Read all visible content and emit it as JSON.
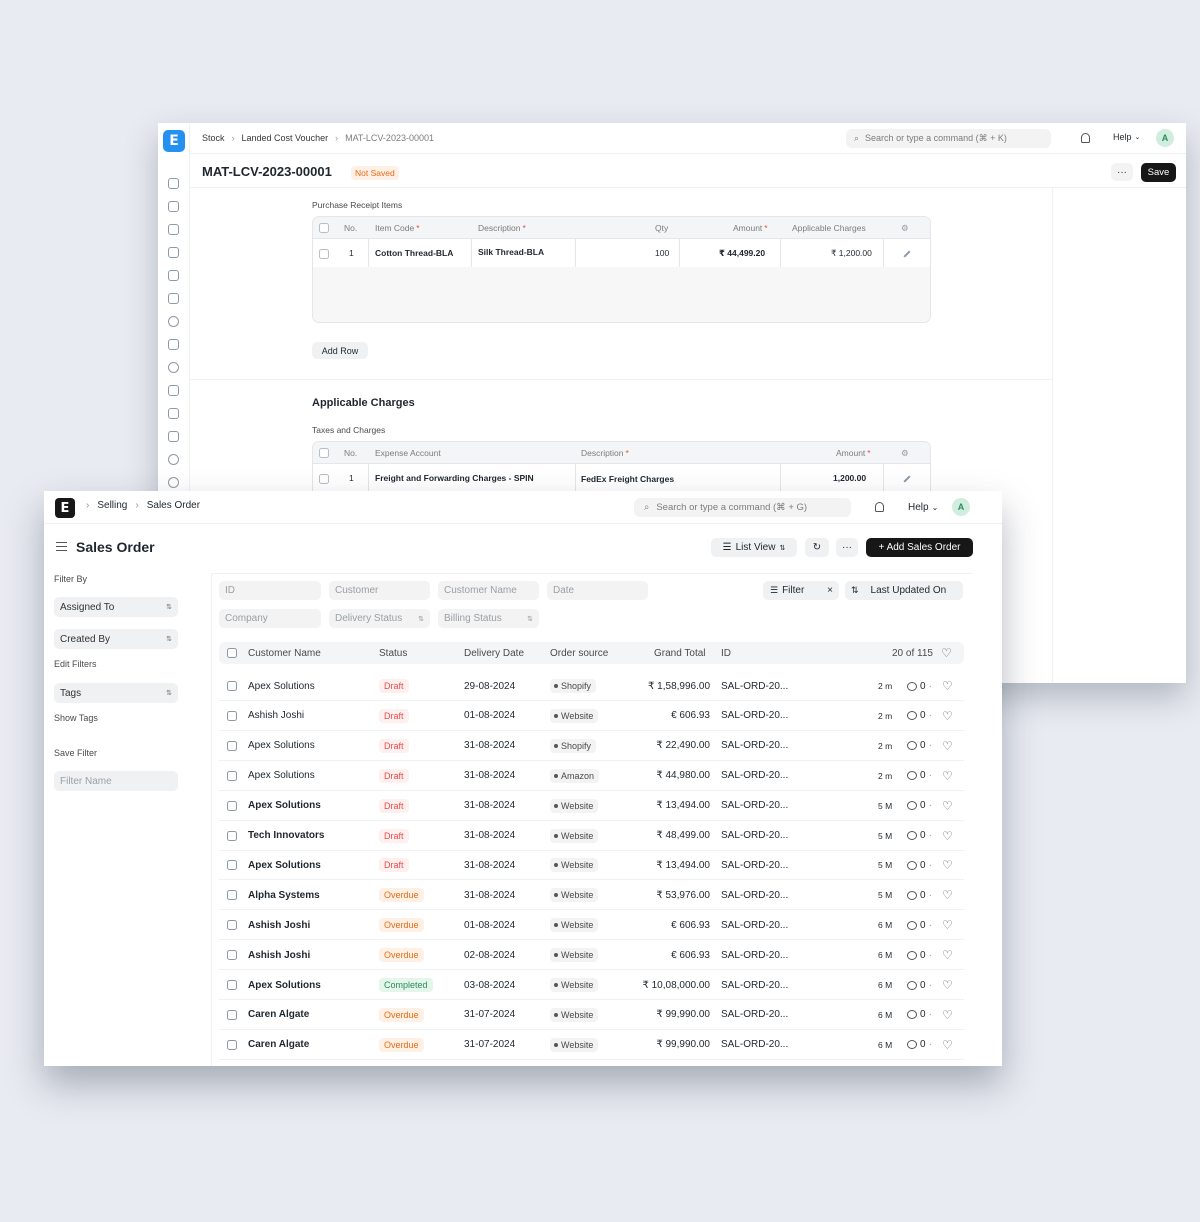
{
  "back": {
    "breadcrumb": [
      "Stock",
      "Landed Cost Voucher",
      "MAT-LCV-2023-00001"
    ],
    "search_placeholder": "Search or type a command (⌘ + K)",
    "help": "Help",
    "avatar": "A",
    "title": "MAT-LCV-2023-00001",
    "status": "Not Saved",
    "save": "Save",
    "more": "···",
    "receipts": {
      "section_label": "Purchase Receipt Items",
      "columns": [
        "No.",
        "Item Code",
        "Description",
        "Qty",
        "Amount",
        "Applicable Charges"
      ],
      "rows": [
        {
          "no": "1",
          "item_code": "Cotton Thread-BLA",
          "description": "Silk Thread-BLA",
          "qty": "100",
          "amount": "₹ 44,499.20",
          "charges": "₹ 1,200.00"
        }
      ],
      "add_row": "Add Row"
    },
    "charges": {
      "title": "Applicable Charges",
      "section_label": "Taxes and Charges",
      "columns": [
        "No.",
        "Expense Account",
        "Description",
        "Amount"
      ],
      "rows": [
        {
          "no": "1",
          "account": "Freight and Forwarding Charges - SPIN",
          "description": "FedEx Freight Charges",
          "amount": "1,200.00"
        }
      ]
    }
  },
  "front": {
    "breadcrumb": [
      "Selling",
      "Sales Order"
    ],
    "search_placeholder": "Search or type a command (⌘ + G)",
    "help": "Help",
    "avatar": "A",
    "title": "Sales Order",
    "list_view": "List View",
    "more": "···",
    "add_button": "+ Add Sales Order",
    "sidebar": {
      "filter_by": "Filter By",
      "assigned_to": "Assigned To",
      "created_by": "Created By",
      "edit_filters": "Edit Filters",
      "tags": "Tags",
      "show_tags": "Show Tags",
      "save_filter": "Save Filter",
      "filter_name_placeholder": "Filter Name"
    },
    "filters": {
      "id": "ID",
      "customer": "Customer",
      "customer_name": "Customer Name",
      "date": "Date",
      "company": "Company",
      "delivery_status": "Delivery Status",
      "billing_status": "Billing Status",
      "filter_button": "Filter",
      "sort": "Last Updated On"
    },
    "columns": {
      "customer_name": "Customer Name",
      "status": "Status",
      "delivery_date": "Delivery Date",
      "order_source": "Order source",
      "grand_total": "Grand Total",
      "id": "ID",
      "count": "20 of 115"
    },
    "rows": [
      {
        "customer": "Apex Solutions",
        "status": "Draft",
        "status_type": "draft",
        "date": "29-08-2024",
        "source": "Shopify",
        "total": "₹ 1,58,996.00",
        "id": "SAL-ORD-20...",
        "age": "2 m",
        "comments": "0"
      },
      {
        "customer": "Ashish Joshi",
        "status": "Draft",
        "status_type": "draft",
        "date": "01-08-2024",
        "source": "Website",
        "total": "€ 606.93",
        "id": "SAL-ORD-20...",
        "age": "2 m",
        "comments": "0"
      },
      {
        "customer": "Apex Solutions",
        "status": "Draft",
        "status_type": "draft",
        "date": "31-08-2024",
        "source": "Shopify",
        "total": "₹ 22,490.00",
        "id": "SAL-ORD-20...",
        "age": "2 m",
        "comments": "0"
      },
      {
        "customer": "Apex Solutions",
        "status": "Draft",
        "status_type": "draft",
        "date": "31-08-2024",
        "source": "Amazon",
        "total": "₹ 44,980.00",
        "id": "SAL-ORD-20...",
        "age": "2 m",
        "comments": "0"
      },
      {
        "customer": "Apex Solutions",
        "status": "Draft",
        "status_type": "draft",
        "date": "31-08-2024",
        "source": "Website",
        "total": "₹ 13,494.00",
        "id": "SAL-ORD-20...",
        "age": "5 M",
        "comments": "0"
      },
      {
        "customer": "Tech Innovators",
        "status": "Draft",
        "status_type": "draft",
        "date": "31-08-2024",
        "source": "Website",
        "total": "₹ 48,499.00",
        "id": "SAL-ORD-20...",
        "age": "5 M",
        "comments": "0"
      },
      {
        "customer": "Apex Solutions",
        "status": "Draft",
        "status_type": "draft",
        "date": "31-08-2024",
        "source": "Website",
        "total": "₹ 13,494.00",
        "id": "SAL-ORD-20...",
        "age": "5 M",
        "comments": "0"
      },
      {
        "customer": "Alpha Systems",
        "status": "Overdue",
        "status_type": "overdue",
        "date": "31-08-2024",
        "source": "Website",
        "total": "₹ 53,976.00",
        "id": "SAL-ORD-20...",
        "age": "5 M",
        "comments": "0"
      },
      {
        "customer": "Ashish Joshi",
        "status": "Overdue",
        "status_type": "overdue",
        "date": "01-08-2024",
        "source": "Website",
        "total": "€ 606.93",
        "id": "SAL-ORD-20...",
        "age": "6 M",
        "comments": "0"
      },
      {
        "customer": "Ashish Joshi",
        "status": "Overdue",
        "status_type": "overdue",
        "date": "02-08-2024",
        "source": "Website",
        "total": "€ 606.93",
        "id": "SAL-ORD-20...",
        "age": "6 M",
        "comments": "0"
      },
      {
        "customer": "Apex Solutions",
        "status": "Completed",
        "status_type": "completed",
        "date": "03-08-2024",
        "source": "Website",
        "total": "₹ 10,08,000.00",
        "id": "SAL-ORD-20...",
        "age": "6 M",
        "comments": "0"
      },
      {
        "customer": "Caren Algate",
        "status": "Overdue",
        "status_type": "overdue",
        "date": "31-07-2024",
        "source": "Website",
        "total": "₹ 99,990.00",
        "id": "SAL-ORD-20...",
        "age": "6 M",
        "comments": "0"
      },
      {
        "customer": "Caren Algate",
        "status": "Overdue",
        "status_type": "overdue",
        "date": "31-07-2024",
        "source": "Website",
        "total": "₹ 99,990.00",
        "id": "SAL-ORD-20...",
        "age": "6 M",
        "comments": "0"
      }
    ]
  },
  "icons": {
    "back_rail": [
      "tools-icon",
      "printer-icon",
      "bag-icon",
      "card-icon",
      "calendar-icon",
      "box-icon",
      "pie-icon",
      "user-icon",
      "shield-icon",
      "folder-icon",
      "server-icon",
      "database-icon",
      "link-icon",
      "headset-icon"
    ]
  }
}
